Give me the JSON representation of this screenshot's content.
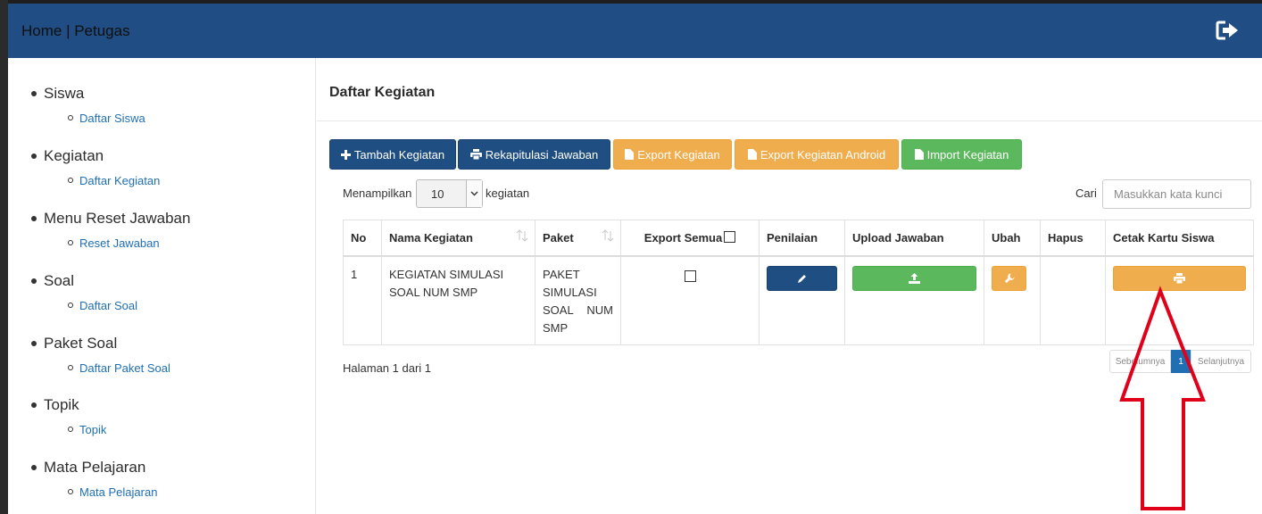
{
  "navbar": {
    "title": "Home | Petugas",
    "logout_icon": "sign-out-icon"
  },
  "sidebar": {
    "groups": [
      {
        "label": "Siswa",
        "link": "Daftar Siswa"
      },
      {
        "label": "Kegiatan",
        "link": "Daftar Kegiatan"
      },
      {
        "label": "Menu Reset Jawaban",
        "link": "Reset Jawaban"
      },
      {
        "label": "Soal",
        "link": "Daftar Soal"
      },
      {
        "label": "Paket Soal",
        "link": "Daftar Paket Soal"
      },
      {
        "label": "Topik",
        "link": "Topik"
      },
      {
        "label": "Mata Pelajaran",
        "link": "Mata Pelajaran"
      }
    ]
  },
  "main": {
    "title": "Daftar Kegiatan",
    "toolbar": {
      "add": "Tambah Kegiatan",
      "recap": "Rekapitulasi Jawaban",
      "export": "Export Kegiatan",
      "export_android": "Export Kegiatan Android",
      "import": "Import Kegiatan"
    },
    "length": {
      "prefix": "Menampilkan",
      "value": "10",
      "suffix": "kegiatan"
    },
    "search": {
      "label": "Cari",
      "placeholder": "Masukkan kata kunci"
    },
    "table": {
      "headers": [
        "No",
        "Nama Kegiatan",
        "Paket",
        "Export Semua",
        "Penilaian",
        "Upload Jawaban",
        "Ubah",
        "Hapus",
        "Cetak Kartu Siswa"
      ],
      "rows": [
        {
          "no": "1",
          "nama": "KEGIATAN SIMULASI SOAL NUM SMP",
          "paket": "PAKET SIMULASI SOAL NUM SMP"
        }
      ]
    },
    "pagination": {
      "info": "Halaman 1 dari 1",
      "prev": "Sebelumnya",
      "current": "1",
      "next": "Selanjutnya"
    }
  },
  "colors": {
    "navbar": "#204d83",
    "primary": "#1f4e82",
    "warning": "#f0ad4e",
    "success": "#5cb85c",
    "annotation": "#e0001a"
  }
}
